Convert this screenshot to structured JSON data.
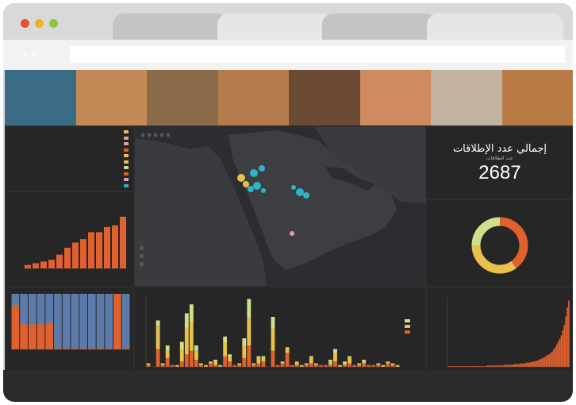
{
  "window": {
    "controls": [
      "#e0572a",
      "#f2b01e",
      "#8dc63f"
    ],
    "tab_count": 4
  },
  "banner": {
    "photo_tones": [
      "#3a6c86",
      "#c48a55",
      "#8c6b4a",
      "#b57b4d",
      "#6b4a35",
      "#d08a5f",
      "#c2b3a0",
      "#b97a45"
    ]
  },
  "dashboard": {
    "kpi": {
      "title": "إجمالي عدد الإطلاقات",
      "subtitle": "عدد الطلاقات",
      "value": "2687"
    },
    "colors": {
      "orange": "#e0602e",
      "yellow": "#e8c04a",
      "green": "#cfe08a",
      "blue": "#5c7bab",
      "teal": "#2ab6c8",
      "pink": "#e59ab0",
      "map_bg": "#2b2d31",
      "land": "#3a3b3e"
    }
  },
  "chart_data": [
    {
      "type": "bar",
      "values": [
        2,
        3,
        4,
        5,
        8,
        12,
        15,
        17,
        21,
        21,
        24,
        25,
        30
      ],
      "ylim": [
        0,
        35
      ]
    },
    {
      "type": "pie",
      "values": [
        40,
        35,
        25
      ]
    },
    {
      "type": "bar",
      "values": [
        [
          80,
          20
        ],
        [
          45,
          55
        ],
        [
          45,
          55
        ],
        [
          45,
          55
        ],
        [
          48,
          52
        ],
        [
          2,
          98
        ],
        [
          2,
          98
        ],
        [
          2,
          98
        ],
        [
          2,
          98
        ],
        [
          2,
          98
        ],
        [
          2,
          98
        ],
        [
          2,
          98
        ],
        [
          100,
          0
        ],
        [
          2,
          98
        ]
      ],
      "ylim": [
        0,
        100
      ]
    },
    {
      "type": "bar",
      "values": [
        [
          1,
          1,
          0
        ],
        [
          0,
          0,
          0
        ],
        [
          10,
          13,
          3
        ],
        [
          1,
          1,
          0
        ],
        [
          5,
          4,
          3
        ],
        [
          1,
          0,
          0
        ],
        [
          0,
          1,
          0
        ],
        [
          3,
          7,
          4
        ],
        [
          7,
          15,
          8
        ],
        [
          9,
          16,
          10
        ],
        [
          4,
          5,
          3
        ],
        [
          1,
          1,
          0
        ],
        [
          0,
          1,
          0
        ],
        [
          2,
          1,
          0
        ],
        [
          1,
          2,
          1
        ],
        [
          0,
          1,
          0
        ],
        [
          6,
          8,
          3
        ],
        [
          3,
          3,
          1
        ],
        [
          1,
          0,
          0
        ],
        [
          1,
          1,
          0
        ],
        [
          5,
          7,
          4
        ],
        [
          12,
          16,
          10
        ],
        [
          1,
          1,
          0
        ],
        [
          2,
          3,
          1
        ],
        [
          3,
          2,
          1
        ],
        [
          0,
          0,
          0
        ],
        [
          9,
          12,
          7
        ],
        [
          1,
          0,
          0
        ],
        [
          2,
          1,
          0
        ],
        [
          8,
          3,
          0
        ],
        [
          1,
          0,
          0
        ],
        [
          1,
          2,
          0
        ],
        [
          0,
          1,
          0
        ],
        [
          1,
          1,
          0
        ],
        [
          2,
          3,
          1
        ],
        [
          1,
          1,
          0
        ],
        [
          1,
          0,
          0
        ],
        [
          1,
          0,
          0
        ],
        [
          1,
          2,
          1
        ],
        [
          3,
          5,
          2
        ],
        [
          0,
          1,
          0
        ],
        [
          1,
          1,
          1
        ],
        [
          2,
          3,
          1
        ],
        [
          1,
          0,
          0
        ],
        [
          1,
          1,
          0
        ],
        [
          2,
          1,
          1
        ],
        [
          1,
          0,
          0
        ],
        [
          1,
          0,
          0
        ],
        [
          1,
          1,
          0
        ],
        [
          0,
          1,
          0
        ],
        [
          2,
          1,
          0
        ],
        [
          1,
          1,
          0
        ],
        [
          0,
          1,
          0
        ]
      ],
      "ylim": [
        0,
        40
      ]
    },
    {
      "type": "bar",
      "values": [
        1,
        1,
        1,
        1,
        1,
        1,
        1,
        1,
        1,
        1,
        1,
        1,
        1,
        1,
        1,
        1,
        1,
        1,
        1,
        1,
        1,
        1,
        1,
        1,
        1,
        1,
        2,
        2,
        2,
        2,
        2,
        2,
        2,
        2,
        2,
        2,
        2,
        3,
        3,
        3,
        3,
        3,
        3,
        3,
        4,
        4,
        4,
        4,
        5,
        5,
        5,
        5,
        6,
        6,
        6,
        7,
        7,
        8,
        8,
        9,
        10,
        11,
        12,
        13,
        14,
        16,
        17,
        18,
        20,
        22,
        25,
        28,
        32,
        36,
        40,
        45,
        52,
        60,
        72,
        85,
        95
      ],
      "ylim": [
        0,
        100
      ]
    }
  ]
}
